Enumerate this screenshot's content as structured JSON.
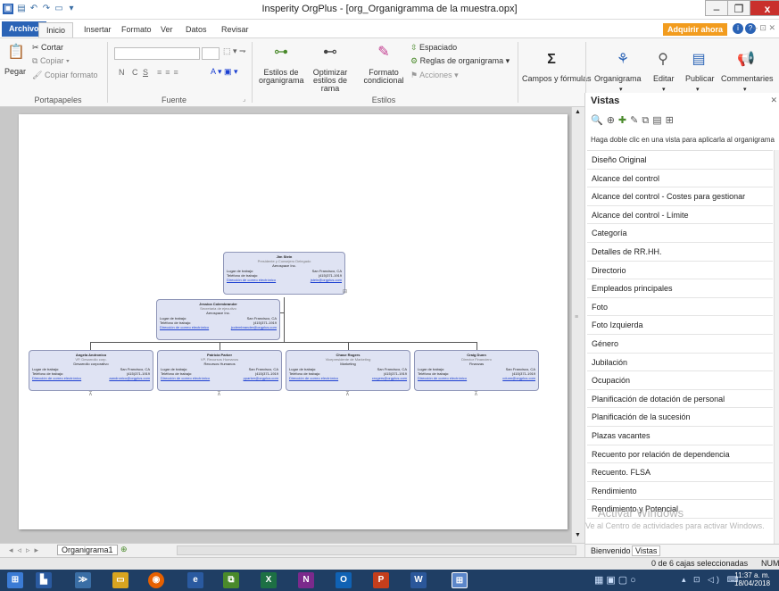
{
  "window": {
    "title": "Insperity OrgPlus - [org_Organigramma de la muestra.opx]",
    "min": "–",
    "max": "❐",
    "close": "x"
  },
  "tabs": [
    {
      "label": "Archivo"
    },
    {
      "label": "Inicio"
    },
    {
      "label": "Insertar"
    },
    {
      "label": "Formato"
    },
    {
      "label": "Ver"
    },
    {
      "label": "Datos"
    },
    {
      "label": "Revisar"
    }
  ],
  "buy_label": "Adquirir ahora",
  "ribbon": {
    "clipboard": {
      "paste": "Pegar",
      "cut": "Cortar",
      "copy": "Copiar",
      "copy_format": "Copiar formato",
      "label": "Portapapeles"
    },
    "font": {
      "bold": "N",
      "italic": "C",
      "underline": "S",
      "label": "Fuente"
    },
    "styles": {
      "estilos": "Estilos de organigrama",
      "optimizar": "Optimizar estilos de rama",
      "formato": "Formato condicional",
      "espaciado": "Espaciado",
      "reglas": "Reglas de organigrama",
      "acciones": "Acciones",
      "label": "Estilos"
    },
    "campos": "Campos y fórmulas",
    "organigrama": "Organigrama",
    "editar": "Editar",
    "publicar": "Publicar",
    "comentarios": "Commentaries"
  },
  "vistas": {
    "title": "Vistas",
    "hint": "Haga doble clic en una vista para aplicarla al organigrama",
    "items": [
      "Diseño Original",
      "Alcance del control",
      "Alcance del control - Costes para gestionar",
      "Alcance del control - Límite",
      "Categoría",
      "Detalles de RR.HH.",
      "Directorio",
      "Empleados principales",
      "Foto",
      "Foto Izquierda",
      "Género",
      "Jubilación",
      "Ocupación",
      "Planificación de dotación de personal",
      "Planificación de la sucesión",
      "Plazas vacantes",
      "Recuento por relación de dependencia",
      "Recuento. FLSA",
      "Rendimiento",
      "Rendimiento y Potencial"
    ],
    "tab_bienvenido": "Bienvenido",
    "tab_vistas": "Vistas"
  },
  "org": {
    "lugar_label": "Lugar de trabajo:",
    "tel_label": "Teléfono de trabajo:",
    "email_label": "Dirección de correo electrónico",
    "root": {
      "name": "Jim Stein",
      "role": "Presidente y Consejero Delegado",
      "company": "Aerospace Inc.",
      "place": "San Francisco, CA",
      "phone": "(415)371-1919",
      "email": "jstein@orgplus.com"
    },
    "assistant": {
      "name": "Jessica Colembrander",
      "role": "Secretaria de ejecutivo",
      "company": "Aerospace Inc.",
      "place": "San Francisco, CA",
      "phone": "(415)371-1919",
      "email": "jcolembrander@orgplus.com"
    },
    "children": [
      {
        "name": "Angela Andronico",
        "role": "VP, Desarrollo corp.",
        "company": "Desarrollo corporativo",
        "place": "San Francisco, CA",
        "phone": "(415)371-1919",
        "email": "aandronico@orgplus.com"
      },
      {
        "name": "Patricia Parker",
        "role": "VP, Recursos Humanos",
        "company": "Recursos Humanos",
        "place": "San Francisco, CA",
        "phone": "(415)371-1919",
        "email": "pparker@orgplus.com"
      },
      {
        "name": "Chase Rogers",
        "role": "Vicepresidente de Marketing",
        "company": "Marketing",
        "place": "San Francisco, CA",
        "phone": "(415)371-1919",
        "email": "crogers@orgplus.com"
      },
      {
        "name": "Craig Dunn",
        "role": "Director Financiero",
        "company": "Finanzas",
        "place": "San Francisco, CA",
        "phone": "(415)371-1919",
        "email": "cdunn@orgplus.com"
      }
    ]
  },
  "sheet_tab": "Organigrama1",
  "status": {
    "selection": "0 de 6 cajas seleccionadas",
    "num": "NUM"
  },
  "watermark": {
    "line1": "Activar Windows",
    "line2": "Ve al Centro de actividades para activar Windows."
  },
  "clock": {
    "time": "11:37 a. m.",
    "date": "18/04/2018"
  }
}
